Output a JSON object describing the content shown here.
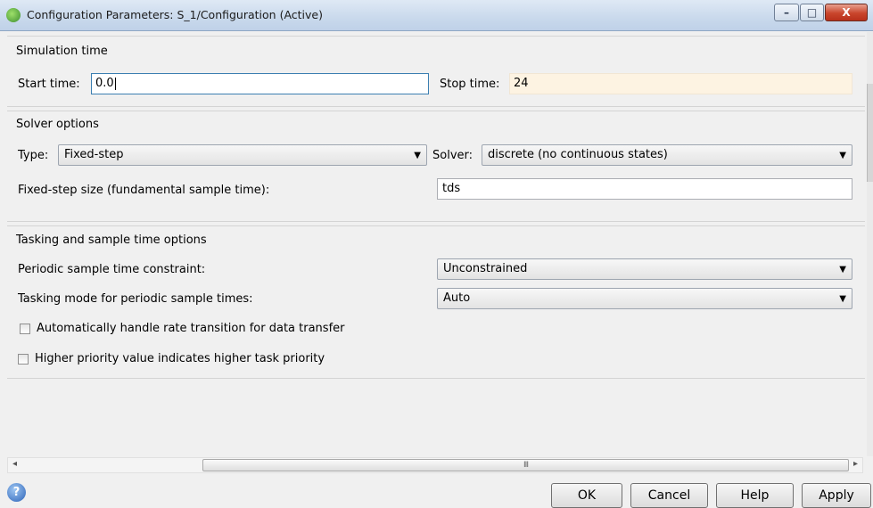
{
  "window": {
    "title": "Configuration Parameters: S_1/Configuration (Active)",
    "minimize_glyph": "–",
    "maximize_glyph": "□",
    "close_glyph": "X"
  },
  "simulation_time": {
    "title": "Simulation time",
    "start_label": "Start time:",
    "start_value": "0.0",
    "stop_label": "Stop time:",
    "stop_value": "24"
  },
  "solver_options": {
    "title": "Solver options",
    "type_label": "Type:",
    "type_value": "Fixed-step",
    "solver_label": "Solver:",
    "solver_value": "discrete (no continuous states)",
    "fixed_step_label": "Fixed-step size (fundamental sample time):",
    "fixed_step_value": "tds"
  },
  "tasking": {
    "title": "Tasking and sample time options",
    "periodic_label": "Periodic sample time constraint:",
    "periodic_value": "Unconstrained",
    "mode_label": "Tasking mode for periodic sample times:",
    "mode_value": "Auto",
    "check_rate_label": "Automatically handle rate transition for data transfer",
    "check_rate_checked": false,
    "check_priority_label": "Higher priority value indicates higher task priority",
    "check_priority_checked": false
  },
  "scrollbar": {
    "left_arrow": "◂",
    "right_arrow": "▸",
    "grip": "III"
  },
  "dropdown_arrow": "▼",
  "footer": {
    "help_icon": "?",
    "ok": "OK",
    "cancel": "Cancel",
    "help": "Help",
    "apply": "Apply"
  },
  "colors": {
    "readonly_field": "#fdf3e2",
    "close_button": "#c9452c",
    "focus_border": "#3c7fb1"
  }
}
